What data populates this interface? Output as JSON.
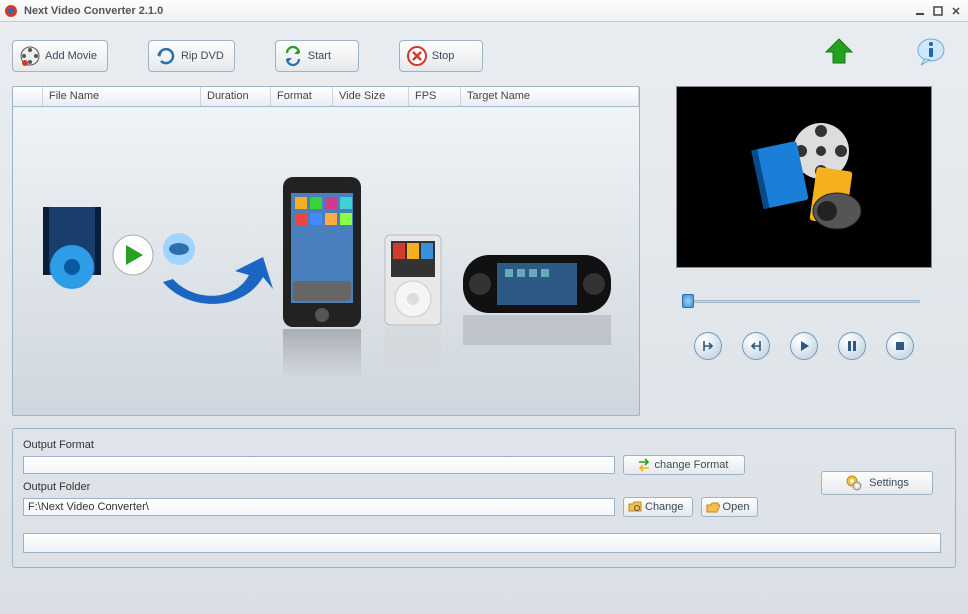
{
  "window": {
    "title": "Next Video Converter 2.1.0"
  },
  "toolbar": {
    "add_movie": "Add Movie",
    "rip_dvd": "Rip DVD",
    "start": "Start",
    "stop": "Stop"
  },
  "columns": {
    "file_name": "File Name",
    "duration": "Duration",
    "format": "Format",
    "video_size": "Vide Size",
    "fps": "FPS",
    "target_name": "Target Name"
  },
  "output": {
    "format_label": "Output Format",
    "format_value": "",
    "folder_label": "Output Folder",
    "folder_value": "F:\\Next Video Converter\\",
    "change_format": "change Format",
    "change": "Change",
    "open": "Open",
    "settings": "Settings"
  },
  "icons": {
    "app": "app-icon",
    "upload": "upload-arrow-icon",
    "info": "info-icon",
    "mark_in": "mark-in-icon",
    "mark_out": "mark-out-icon",
    "play": "play-icon",
    "pause": "pause-icon",
    "stop": "stop-icon"
  },
  "colors": {
    "accent": "#2d6fa8",
    "green": "#24a21f",
    "red": "#d43a2a"
  }
}
